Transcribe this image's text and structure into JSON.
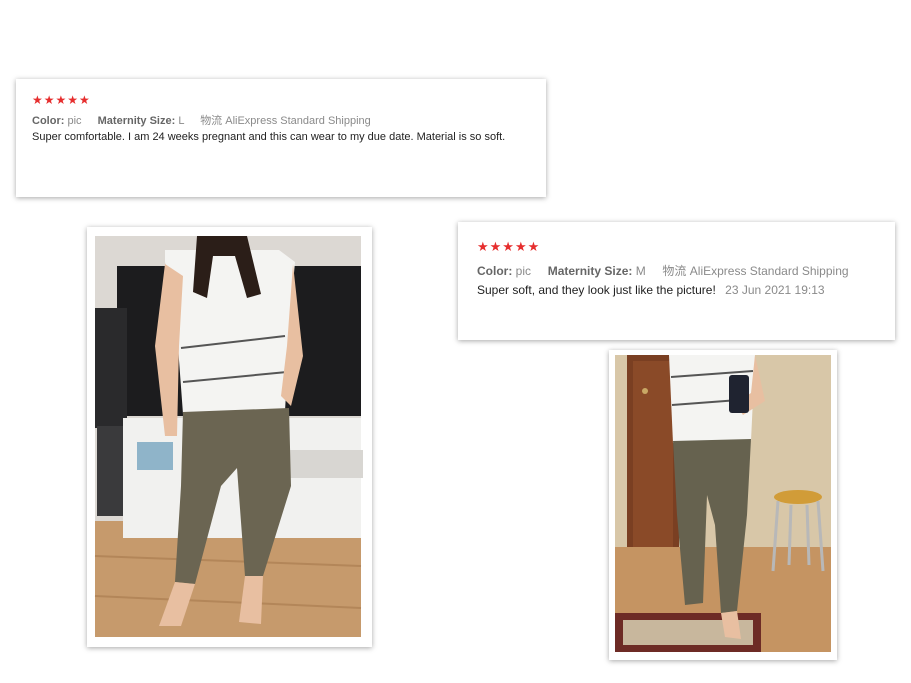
{
  "reviews": [
    {
      "stars": "★★★★★",
      "color_label": "Color:",
      "color_value": "pic",
      "size_label": "Maternity Size:",
      "size_value": "L",
      "shipping_label": "物流",
      "shipping_value": "AliExpress Standard Shipping",
      "text": "Super comfortable. I am 24 weeks pregnant and this can wear to my due date. Material is so soft."
    },
    {
      "stars": "★★★★★",
      "color_label": "Color:",
      "color_value": "pic",
      "size_label": "Maternity Size:",
      "size_value": "M",
      "shipping_label": "物流",
      "shipping_value": "AliExpress Standard Shipping",
      "text": "Super soft, and they look just like the picture!",
      "date": "23 Jun 2021 19:13"
    }
  ],
  "colors": {
    "star": "#e62e2e",
    "pants": "#6b6552",
    "top": "#f4f4f2",
    "floor": "#c69a6c"
  }
}
